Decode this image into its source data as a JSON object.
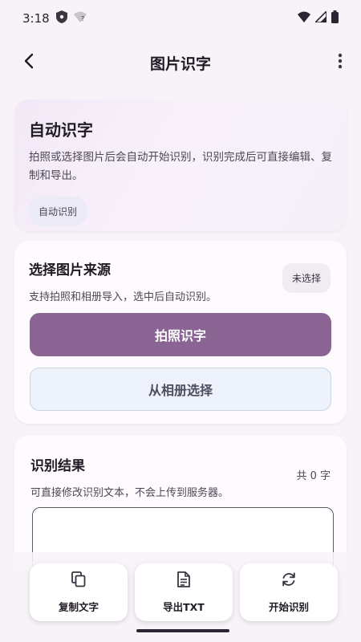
{
  "status_bar": {
    "time": "3:18"
  },
  "app_bar": {
    "title": "图片识字"
  },
  "hero": {
    "title": "自动识字",
    "description": "拍照或选择图片后会自动开始识别，识别完成后可直接编辑、复制和导出。",
    "badge": "自动识别"
  },
  "source": {
    "title": "选择图片来源",
    "description": "支持拍照和相册导入，选中后自动识别。",
    "status_chip": "未选择",
    "camera_button": "拍照识字",
    "gallery_button": "从相册选择"
  },
  "result": {
    "title": "识别结果",
    "count": "共 0 字",
    "description": "可直接修改识别文本，不会上传到服务器。",
    "text_value": ""
  },
  "actions": [
    {
      "label": "复制文字",
      "icon": "copy-icon"
    },
    {
      "label": "导出TXT",
      "icon": "document-icon"
    },
    {
      "label": "开始识别",
      "icon": "refresh-icon"
    }
  ],
  "colors": {
    "primary": "#8a6594",
    "secondary_bg": "#edf2fb",
    "background": "#f7f3f8"
  }
}
